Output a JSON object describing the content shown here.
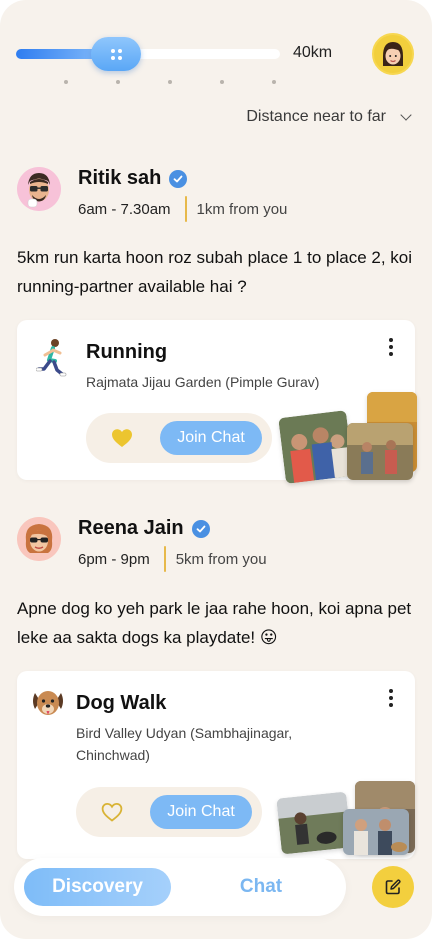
{
  "filter": {
    "distance_readout": "40km",
    "slider_level_fraction": 0.38,
    "tick_count": 5,
    "fill_color": "#2f7df0",
    "thumb_icon": "grip-dots-icon"
  },
  "header": {
    "profile_avatar_icon": "woman-avatar-icon"
  },
  "sort": {
    "label": "Distance near to far",
    "icon": "chevron-down-icon"
  },
  "posts": [
    {
      "author": "Ritik sah",
      "verified": true,
      "time": "6am - 7.30am",
      "distance": "1km from you",
      "text": "5km run karta hoon roz subah place 1 to place 2, koi running-partner available hai ?",
      "activity": {
        "icon": "runner-icon",
        "title": "Running",
        "location": "Rajmata Jijau Garden (Pimple Gurav)",
        "liked": true,
        "join_label": "Join Chat"
      }
    },
    {
      "author": "Reena Jain",
      "verified": true,
      "time": "6pm - 9pm",
      "distance": "5km from you",
      "text": "Apne dog ko yeh park le jaa rahe hoon, koi apna pet leke aa sakta dogs ka playdate! 😛",
      "activity": {
        "icon": "dog-face-icon",
        "title": "Dog Walk",
        "location": "Bird Valley Udyan (Sambhajinagar, Chinchwad)",
        "liked": false,
        "join_label": "Join Chat"
      }
    }
  ],
  "nav": {
    "tabs": [
      {
        "label": "Discovery",
        "active": true
      },
      {
        "label": "Chat",
        "active": false
      }
    ],
    "compose_icon": "compose-icon"
  },
  "colors": {
    "background": "#f7f2ec",
    "accent_blue": "#7db9f5",
    "accent_yellow": "#f3cf3e",
    "verified_blue": "#4a90e2",
    "divider_gold": "#e7b94a"
  }
}
